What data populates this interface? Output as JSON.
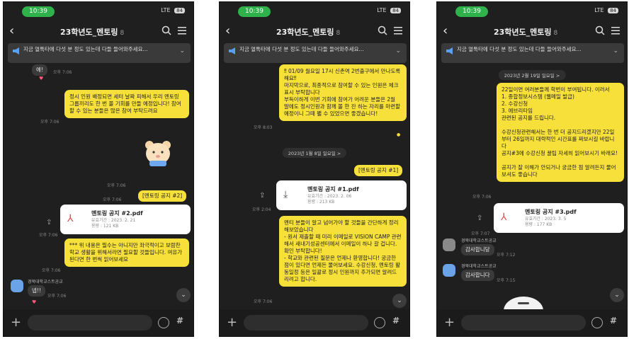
{
  "phones": [
    {
      "status": {
        "time": "10:39",
        "network": "LTE",
        "battery": "84"
      },
      "header": {
        "title": "23학년도_멘토링",
        "member_count": "8"
      },
      "notice": {
        "text": "지금 열톡타에 다섯 분 정도 있는데 다들 들어와주세요..."
      },
      "messages": {
        "top_bubble": "예!",
        "top_time": "오후 7:06",
        "bubble1": "정시 인원 배정되면 세터 날짜 피해서 우리 멘토링 그룹끼리도 한 번 볼 기회를 만들 예정입니다! 참여할 수 있는 분들은 많은 참여 부탁드려요",
        "bubble1_time": "오후 7:06",
        "emoticon_time": "오후 7:06",
        "link_bubble": "[멘토링 공지 #2]",
        "link_time": "오후 7:06",
        "file_name": "멘토링 공지 #2.pdf",
        "file_detail": "유효기간 : 2023. 2. 21\n용량 : 121 KB",
        "file_time": "오후 7:06",
        "bubble2": "*** 위 내용은 필수는 아니지만 좌극적이고 보람찬 학교 생활을 위해서라면 필요할 것들입니다. 여유가 된다면 한 번씩 읽어보세요",
        "bubble2_time": "오후 7:06",
        "sender": "경북대학교스트공교",
        "reply": "넵!!",
        "reply_time": "오후 7:06"
      }
    },
    {
      "status": {
        "time": "10:39",
        "network": "LTE",
        "battery": "84"
      },
      "header": {
        "title": "23학년도_멘토링",
        "member_count": "8"
      },
      "notice": {
        "text": "지금 열톡타에 다섯 분 정도 있는데 다들 들어와주세요..."
      },
      "messages": {
        "bubble1": "‼ 01/09 월요일 17시 신촌역 2번출구에서 만나도록 해요‼\n마지막으로, 최종적으로 참여할 수 있는 인원은 체크 표시 부탁합니다\n부득이하게 이번 기회에 참여가 어려운 분들은 2월 말에도 정시인원과 함께 볼 한 잔 하는 자리를 마련할 예정이니 그때 봴 수 있었으면 좋겠습니다!",
        "bubble1_time": "오후 8:03",
        "date_pill": "2023년 1월 8일 일요일 >",
        "link_bubble": "[멘토링 공지 #1]",
        "file_name": "멘토링 공지 #1.pdf",
        "file_detail": "유효기간 : 2023. 2. 06\n용량 : 213 KB",
        "file_time": "오후 2:04",
        "bubble2": "멘티 분들이 알고 넘어가야 할 것들을 간단하게 정리해보았습니다\n- 원서 제출할 때 미리 이메일로 VISION CAMP 관련해서 새내기성공센터에서 이메일이 하나 갈 겁니다. 확인 부탁합니다!\n- 학교와 관련된 질문은 언제나 환영합니다! 궁금한 점이 있다면 언제든 물어보세요. 수강신청, 멘토링 활동일정 등은 일괄로 정시 인원까지 추가되면 알려드리려고 합니다.",
        "bubble2_time": "오후 7:06"
      }
    },
    {
      "status": {
        "time": "10:39",
        "network": "LTE",
        "battery": "84"
      },
      "header": {
        "title": "23학년도_멘토링",
        "member_count": "8"
      },
      "notice": {
        "text": "지금 열톡타에 다섯 분 정도 있는데 다들 들어와주세요..."
      },
      "messages": {
        "date_pill": "2023년 2월 19일 일요일 >",
        "bubble1": "22일이면 여러분들께 학번이 부여됩니다. 이러서\n1. 종합정보시스템 (웹메일 발급)\n2. 수강신청\n3. 에브리타임\n관련된 공지를 드립니다.\n\n수강신청관련해서는 한 번 더 공지드리겠지만 22일부터 26일까지 대략적인 시간표를 짜보시길 바랍니다\n공지#3에 수강신청 꿀팁 자세히 읽어보시기 바래요!\n\n공지가 잘 이해가 안되거나 궁금한 점 알려든지 물어보셔도 좋습니다",
        "bubble1_time": "오후 7:06",
        "file_name": "멘토링 공지 #3.pdf",
        "file_detail": "유효기간 : 2023. 3. 5\n용량 : 177 KB",
        "file_time": "오후 7:07",
        "sender1": "경북대학교스트공교",
        "reply1": "감사합니당",
        "reply1_time": "오후 7:12",
        "sender2": "경북대학교스트공교",
        "reply2": "감사합니다",
        "reply2_time": "오후 7:15"
      }
    }
  ],
  "colors": {
    "bubble_yellow": "#f7e03a",
    "background": "#1f1f1f",
    "status_green": "#2fb24c"
  },
  "icons": [
    "back-arrow-icon",
    "search-icon",
    "menu-icon",
    "megaphone-icon",
    "chevron-down-icon",
    "pdf-icon",
    "share-icon",
    "plus-icon",
    "emoji-icon",
    "hash-icon"
  ]
}
